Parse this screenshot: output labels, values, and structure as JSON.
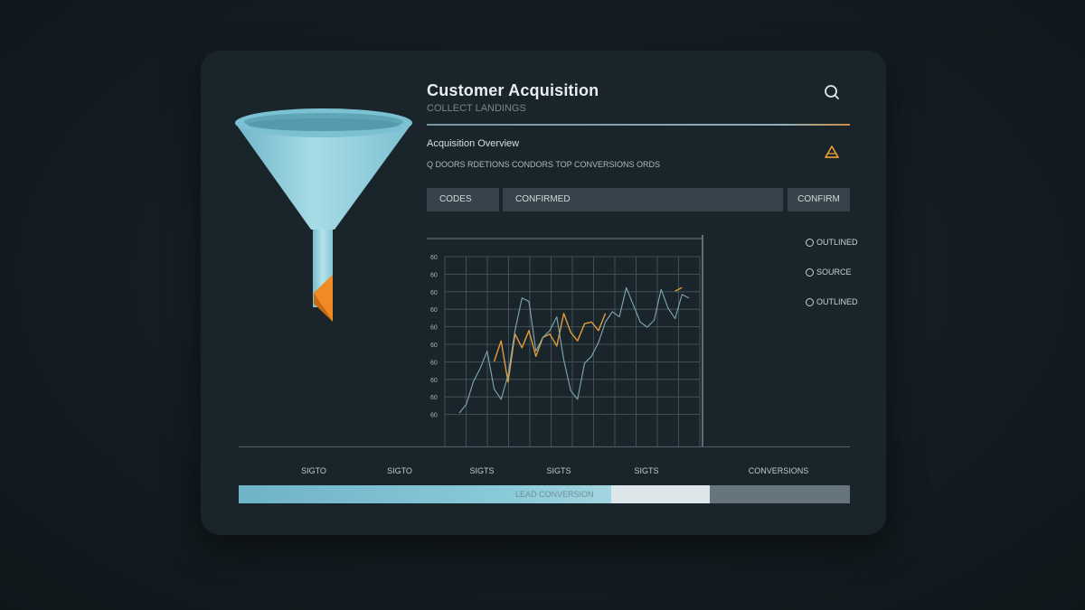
{
  "header": {
    "title": "Customer Acquisition",
    "subtitle": "COLLECT LANDINGS"
  },
  "section": {
    "title": "Acquisition Overview",
    "description": "Q DOORS RDETIONS CONDORS TOP CONVERSIONS ORDS"
  },
  "tabs": [
    {
      "label": "CODES"
    },
    {
      "label": "CONFIRMED"
    },
    {
      "label": "CONFIRM"
    }
  ],
  "legend": [
    {
      "label": "OUTLINED"
    },
    {
      "label": "SOURCE"
    },
    {
      "label": "OUTLINED"
    }
  ],
  "buckets": [
    "SIGTO",
    "SIGTO",
    "SIGTS",
    "SIGTS",
    "SIGTS",
    "CONVERSIONS"
  ],
  "progress": {
    "label": "LEAD CONVERSION",
    "segment_a_fraction": 0.61,
    "segment_b_fraction": 0.16
  },
  "icons": {
    "search": "search-icon",
    "alert": "alert-icon",
    "funnel": "funnel-icon"
  },
  "colors": {
    "accent": "#e59a35",
    "funnel": "#8fd0e0",
    "series_primary": "#e29a3b",
    "series_secondary": "#7fa9b4"
  },
  "chart_data": {
    "type": "line",
    "ylabels": [
      "60",
      "60",
      "60",
      "60",
      "60",
      "60",
      "60",
      "60",
      "60",
      "60"
    ],
    "x": [
      0,
      1,
      2,
      3,
      4,
      5,
      6,
      7,
      8,
      9,
      10,
      11,
      12,
      13,
      14,
      15,
      16,
      17,
      18,
      19,
      20,
      21,
      22,
      23,
      24,
      25,
      26,
      27,
      28,
      29,
      30,
      31,
      32,
      33
    ],
    "grid": true,
    "series": [
      {
        "values": [
          null,
          null,
          null,
          null,
          null,
          4.0,
          5.2,
          2.8,
          5.6,
          4.8,
          5.8,
          4.3,
          5.4,
          5.6,
          4.9,
          6.8,
          5.7,
          5.2,
          6.2,
          6.3,
          5.8,
          6.8,
          null,
          null,
          null,
          null,
          null,
          null,
          null,
          null,
          null,
          8.1,
          8.3,
          null
        ]
      },
      {
        "values": [
          1.0,
          1.5,
          2.8,
          3.6,
          4.6,
          2.4,
          1.8,
          3.2,
          5.8,
          7.7,
          7.5,
          4.6,
          5.4,
          5.8,
          6.6,
          4.1,
          2.3,
          1.8,
          3.9,
          4.3,
          5.1,
          6.3,
          6.9,
          6.6,
          8.3,
          7.3,
          6.3,
          6.0,
          6.4,
          8.2,
          7.1,
          6.5,
          7.9,
          7.7
        ]
      }
    ]
  }
}
